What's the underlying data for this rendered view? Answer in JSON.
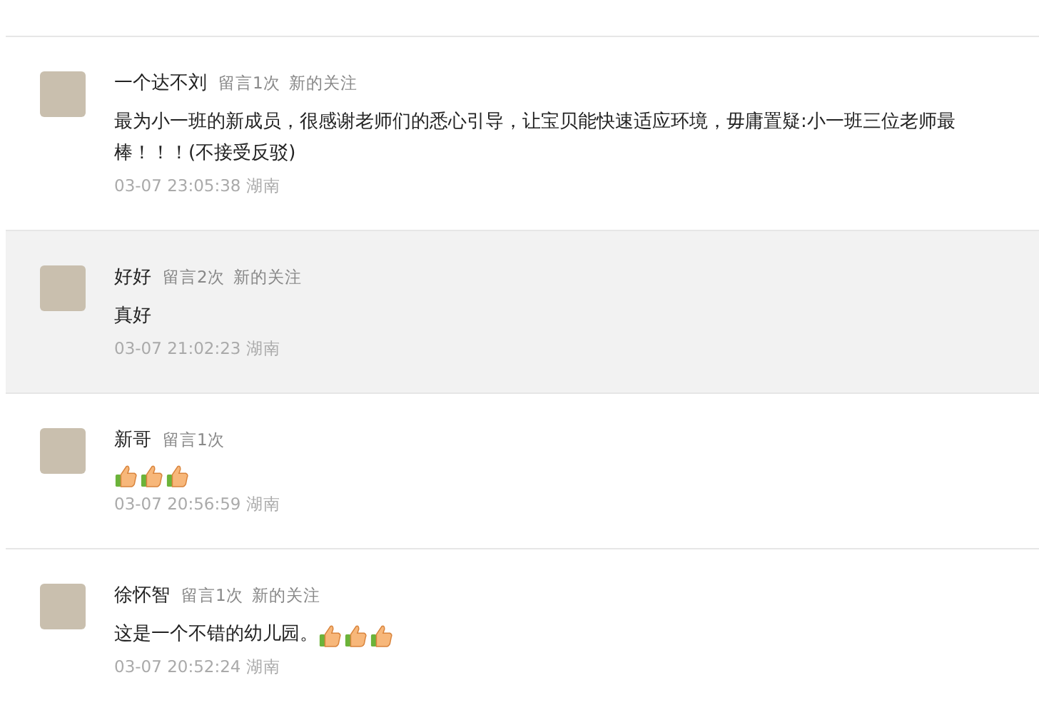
{
  "comments": [
    {
      "name": "一个达不刘",
      "tags": [
        "留言1次",
        "新的关注"
      ],
      "text": "最为小一班的新成员，很感谢老师们的悉心引导，让宝贝能快速适应环境，毋庸置疑:小一班三位老师最棒！！！(不接受反驳)",
      "time": "03-07 23:05:38",
      "region": "湖南",
      "highlighted": false
    },
    {
      "name": "好好",
      "tags": [
        "留言2次",
        "新的关注"
      ],
      "text": "真好",
      "time": "03-07 21:02:23",
      "region": "湖南",
      "highlighted": true
    },
    {
      "name": "新哥",
      "tags": [
        "留言1次"
      ],
      "reactions": [
        {
          "kind": "thumbs_up"
        },
        {
          "kind": "thumbs_up"
        },
        {
          "kind": "thumbs_up"
        }
      ],
      "time": "03-07 20:56:59",
      "region": "湖南",
      "highlighted": false
    },
    {
      "name": "徐怀智",
      "tags": [
        "留言1次",
        "新的关注"
      ],
      "text": "这是一个不错的幼儿园。",
      "reactions": [
        {
          "kind": "thumbs_up"
        },
        {
          "kind": "thumbs_up"
        },
        {
          "kind": "thumbs_up"
        }
      ],
      "time": "03-07 20:52:24",
      "region": "湖南",
      "highlighted": false
    }
  ]
}
